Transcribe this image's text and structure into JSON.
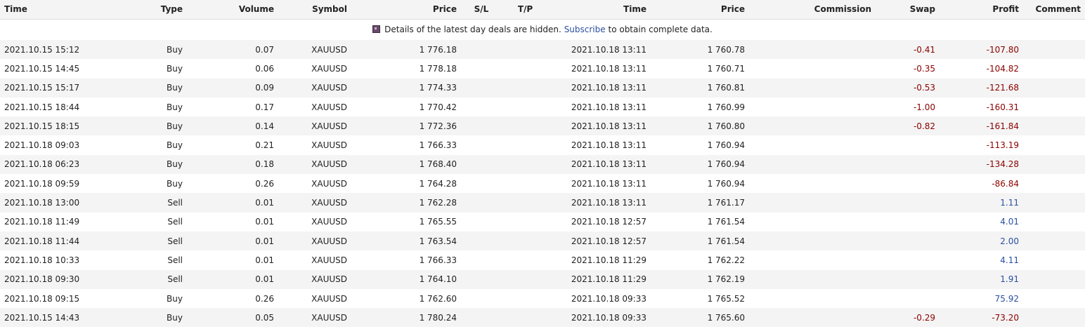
{
  "headers": {
    "time_open": "Time",
    "type": "Type",
    "volume": "Volume",
    "symbol": "Symbol",
    "price_open": "Price",
    "sl": "S/L",
    "tp": "T/P",
    "time_close": "Time",
    "price_close": "Price",
    "commission": "Commission",
    "swap": "Swap",
    "profit": "Profit",
    "comment": "Comment"
  },
  "notice": {
    "icon": "lock-icon",
    "text_before": "Details of the latest day deals are hidden.",
    "link": "Subscribe",
    "text_after": "to obtain complete data."
  },
  "colors": {
    "negative": "#8b0000",
    "positive": "#2a4fa0",
    "stripe": "#f4f4f4"
  },
  "rows": [
    {
      "time_open": "2021.10.15 15:12",
      "type": "Buy",
      "volume": "0.07",
      "symbol": "XAUUSD",
      "price_open": "1 776.18",
      "sl": "",
      "tp": "",
      "time_close": "2021.10.18 13:11",
      "price_close": "1 760.78",
      "commission": "",
      "swap": "-0.41",
      "profit": "-107.80",
      "comment": ""
    },
    {
      "time_open": "2021.10.15 14:45",
      "type": "Buy",
      "volume": "0.06",
      "symbol": "XAUUSD",
      "price_open": "1 778.18",
      "sl": "",
      "tp": "",
      "time_close": "2021.10.18 13:11",
      "price_close": "1 760.71",
      "commission": "",
      "swap": "-0.35",
      "profit": "-104.82",
      "comment": ""
    },
    {
      "time_open": "2021.10.15 15:17",
      "type": "Buy",
      "volume": "0.09",
      "symbol": "XAUUSD",
      "price_open": "1 774.33",
      "sl": "",
      "tp": "",
      "time_close": "2021.10.18 13:11",
      "price_close": "1 760.81",
      "commission": "",
      "swap": "-0.53",
      "profit": "-121.68",
      "comment": ""
    },
    {
      "time_open": "2021.10.15 18:44",
      "type": "Buy",
      "volume": "0.17",
      "symbol": "XAUUSD",
      "price_open": "1 770.42",
      "sl": "",
      "tp": "",
      "time_close": "2021.10.18 13:11",
      "price_close": "1 760.99",
      "commission": "",
      "swap": "-1.00",
      "profit": "-160.31",
      "comment": ""
    },
    {
      "time_open": "2021.10.15 18:15",
      "type": "Buy",
      "volume": "0.14",
      "symbol": "XAUUSD",
      "price_open": "1 772.36",
      "sl": "",
      "tp": "",
      "time_close": "2021.10.18 13:11",
      "price_close": "1 760.80",
      "commission": "",
      "swap": "-0.82",
      "profit": "-161.84",
      "comment": ""
    },
    {
      "time_open": "2021.10.18 09:03",
      "type": "Buy",
      "volume": "0.21",
      "symbol": "XAUUSD",
      "price_open": "1 766.33",
      "sl": "",
      "tp": "",
      "time_close": "2021.10.18 13:11",
      "price_close": "1 760.94",
      "commission": "",
      "swap": "",
      "profit": "-113.19",
      "comment": ""
    },
    {
      "time_open": "2021.10.18 06:23",
      "type": "Buy",
      "volume": "0.18",
      "symbol": "XAUUSD",
      "price_open": "1 768.40",
      "sl": "",
      "tp": "",
      "time_close": "2021.10.18 13:11",
      "price_close": "1 760.94",
      "commission": "",
      "swap": "",
      "profit": "-134.28",
      "comment": ""
    },
    {
      "time_open": "2021.10.18 09:59",
      "type": "Buy",
      "volume": "0.26",
      "symbol": "XAUUSD",
      "price_open": "1 764.28",
      "sl": "",
      "tp": "",
      "time_close": "2021.10.18 13:11",
      "price_close": "1 760.94",
      "commission": "",
      "swap": "",
      "profit": "-86.84",
      "comment": ""
    },
    {
      "time_open": "2021.10.18 13:00",
      "type": "Sell",
      "volume": "0.01",
      "symbol": "XAUUSD",
      "price_open": "1 762.28",
      "sl": "",
      "tp": "",
      "time_close": "2021.10.18 13:11",
      "price_close": "1 761.17",
      "commission": "",
      "swap": "",
      "profit": "1.11",
      "comment": ""
    },
    {
      "time_open": "2021.10.18 11:49",
      "type": "Sell",
      "volume": "0.01",
      "symbol": "XAUUSD",
      "price_open": "1 765.55",
      "sl": "",
      "tp": "",
      "time_close": "2021.10.18 12:57",
      "price_close": "1 761.54",
      "commission": "",
      "swap": "",
      "profit": "4.01",
      "comment": ""
    },
    {
      "time_open": "2021.10.18 11:44",
      "type": "Sell",
      "volume": "0.01",
      "symbol": "XAUUSD",
      "price_open": "1 763.54",
      "sl": "",
      "tp": "",
      "time_close": "2021.10.18 12:57",
      "price_close": "1 761.54",
      "commission": "",
      "swap": "",
      "profit": "2.00",
      "comment": ""
    },
    {
      "time_open": "2021.10.18 10:33",
      "type": "Sell",
      "volume": "0.01",
      "symbol": "XAUUSD",
      "price_open": "1 766.33",
      "sl": "",
      "tp": "",
      "time_close": "2021.10.18 11:29",
      "price_close": "1 762.22",
      "commission": "",
      "swap": "",
      "profit": "4.11",
      "comment": ""
    },
    {
      "time_open": "2021.10.18 09:30",
      "type": "Sell",
      "volume": "0.01",
      "symbol": "XAUUSD",
      "price_open": "1 764.10",
      "sl": "",
      "tp": "",
      "time_close": "2021.10.18 11:29",
      "price_close": "1 762.19",
      "commission": "",
      "swap": "",
      "profit": "1.91",
      "comment": ""
    },
    {
      "time_open": "2021.10.18 09:15",
      "type": "Buy",
      "volume": "0.26",
      "symbol": "XAUUSD",
      "price_open": "1 762.60",
      "sl": "",
      "tp": "",
      "time_close": "2021.10.18 09:33",
      "price_close": "1 765.52",
      "commission": "",
      "swap": "",
      "profit": "75.92",
      "comment": ""
    },
    {
      "time_open": "2021.10.15 14:43",
      "type": "Buy",
      "volume": "0.05",
      "symbol": "XAUUSD",
      "price_open": "1 780.24",
      "sl": "",
      "tp": "",
      "time_close": "2021.10.18 09:33",
      "price_close": "1 765.60",
      "commission": "",
      "swap": "-0.29",
      "profit": "-73.20",
      "comment": ""
    }
  ]
}
